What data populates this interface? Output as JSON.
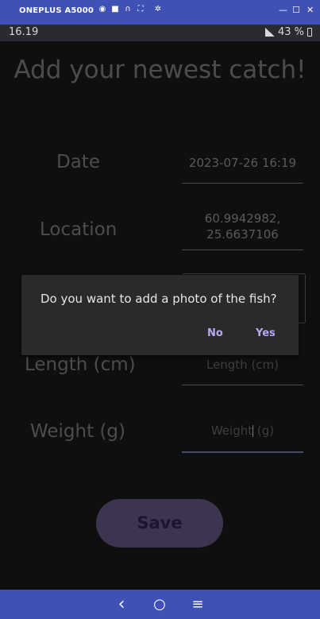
{
  "emulator": {
    "device_name": "ONEPLUS A5000",
    "tools": [
      "camera-icon",
      "video-icon",
      "headphones-icon",
      "fullscreen-icon",
      "settings-icon"
    ],
    "window_controls": {
      "minimize": "—",
      "maximize": "☐",
      "close": "✕"
    }
  },
  "status_bar": {
    "time": "16.19",
    "battery": "43 %"
  },
  "page": {
    "title": "Add your newest catch!"
  },
  "form": {
    "date": {
      "label": "Date",
      "value": "2023-07-26 16:19"
    },
    "location": {
      "label": "Location",
      "value_line1": "60.9942982,",
      "value_line2": "25.6637106"
    },
    "length": {
      "label": "Length (cm)",
      "placeholder": "Length (cm)"
    },
    "weight": {
      "label": "Weight (g)",
      "placeholder_before": "Weight",
      "placeholder_after": " (g)"
    }
  },
  "save_button": {
    "label": "Save"
  },
  "dialog": {
    "message": "Do you want to add a photo of the fish?",
    "no": "No",
    "yes": "Yes"
  },
  "nav": {
    "back": "‹",
    "home": "○",
    "recents": "≡"
  },
  "colors": {
    "accent": "#3f51b5",
    "dialog_button": "#b9a6f5",
    "save_button": "#3d3550"
  }
}
